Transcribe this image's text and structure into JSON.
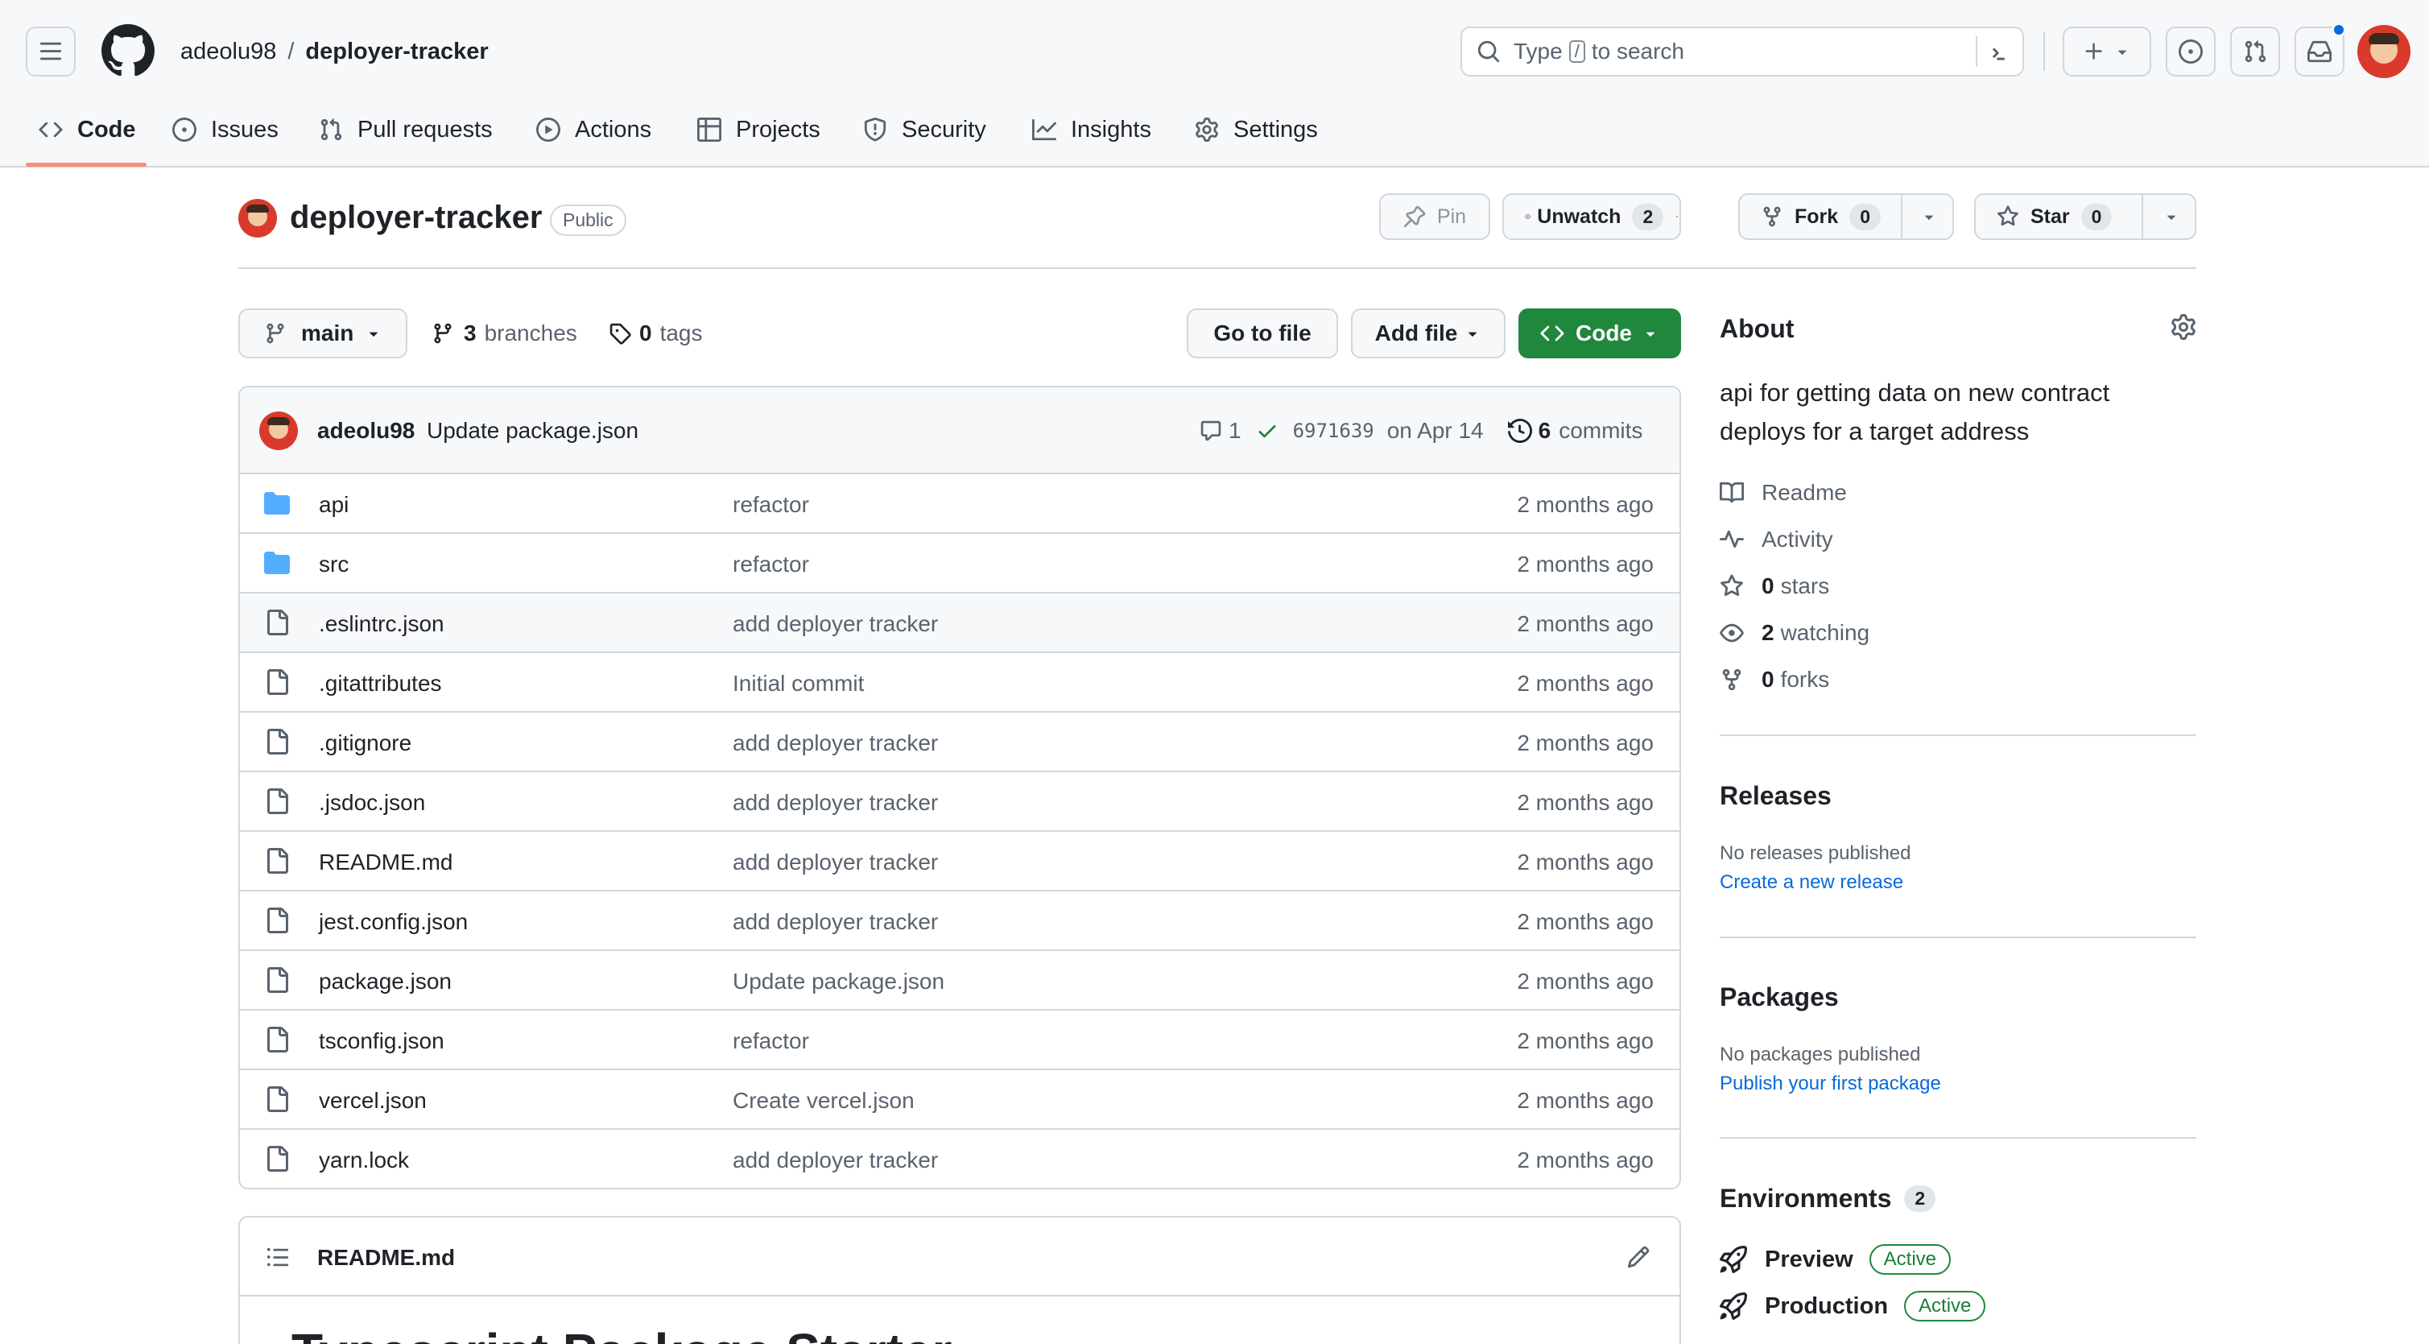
{
  "header": {
    "owner": "adeolu98",
    "separator": "/",
    "repo": "deployer-tracker",
    "search_prefix": "Type",
    "search_key": "/",
    "search_suffix": "to search"
  },
  "nav": {
    "tabs": [
      {
        "label": "Code",
        "icon": "code-icon"
      },
      {
        "label": "Issues",
        "icon": "issue-icon"
      },
      {
        "label": "Pull requests",
        "icon": "pull-request-icon"
      },
      {
        "label": "Actions",
        "icon": "play-icon"
      },
      {
        "label": "Projects",
        "icon": "table-icon"
      },
      {
        "label": "Security",
        "icon": "shield-icon"
      },
      {
        "label": "Insights",
        "icon": "graph-icon"
      },
      {
        "label": "Settings",
        "icon": "gear-icon"
      }
    ]
  },
  "repo": {
    "name": "deployer-tracker",
    "visibility": "Public",
    "pin": "Pin",
    "unwatch": "Unwatch",
    "watch_count": "2",
    "fork": "Fork",
    "fork_count": "0",
    "star": "Star",
    "star_count": "0"
  },
  "toolbar": {
    "branch": "main",
    "branches_count": "3",
    "branches_label": "branches",
    "tags_count": "0",
    "tags_label": "tags",
    "goto_file": "Go to file",
    "add_file": "Add file",
    "code": "Code"
  },
  "commit": {
    "author": "adeolu98",
    "message": "Update package.json",
    "comments": "1",
    "sha": "6971639",
    "date": "on Apr 14",
    "commits_count": "6",
    "commits_label": "commits"
  },
  "files": [
    {
      "name": "api",
      "type": "dir",
      "message": "refactor",
      "age": "2 months ago"
    },
    {
      "name": "src",
      "type": "dir",
      "message": "refactor",
      "age": "2 months ago"
    },
    {
      "name": ".eslintrc.json",
      "type": "file",
      "message": "add deployer tracker",
      "age": "2 months ago"
    },
    {
      "name": ".gitattributes",
      "type": "file",
      "message": "Initial commit",
      "age": "2 months ago"
    },
    {
      "name": ".gitignore",
      "type": "file",
      "message": "add deployer tracker",
      "age": "2 months ago"
    },
    {
      "name": ".jsdoc.json",
      "type": "file",
      "message": "add deployer tracker",
      "age": "2 months ago"
    },
    {
      "name": "README.md",
      "type": "file",
      "message": "add deployer tracker",
      "age": "2 months ago"
    },
    {
      "name": "jest.config.json",
      "type": "file",
      "message": "add deployer tracker",
      "age": "2 months ago"
    },
    {
      "name": "package.json",
      "type": "file",
      "message": "Update package.json",
      "age": "2 months ago"
    },
    {
      "name": "tsconfig.json",
      "type": "file",
      "message": "refactor",
      "age": "2 months ago"
    },
    {
      "name": "vercel.json",
      "type": "file",
      "message": "Create vercel.json",
      "age": "2 months ago"
    },
    {
      "name": "yarn.lock",
      "type": "file",
      "message": "add deployer tracker",
      "age": "2 months ago"
    }
  ],
  "readme": {
    "file": "README.md",
    "heading": "Typescript Package Starter"
  },
  "about": {
    "title": "About",
    "description": "api for getting data on new contract deploys for a target address",
    "readme": "Readme",
    "activity": "Activity",
    "stars_count": "0",
    "stars_label": "stars",
    "watching_count": "2",
    "watching_label": "watching",
    "forks_count": "0",
    "forks_label": "forks"
  },
  "releases": {
    "title": "Releases",
    "empty": "No releases published",
    "link": "Create a new release"
  },
  "packages": {
    "title": "Packages",
    "empty": "No packages published",
    "link": "Publish your first package"
  },
  "environments": {
    "title": "Environments",
    "count": "2",
    "items": [
      {
        "name": "Preview",
        "status": "Active"
      },
      {
        "name": "Production",
        "status": "Active"
      }
    ]
  },
  "colors": {
    "accent_underline": "#fd8c73",
    "primary_green": "#1f883d",
    "link_blue": "#0969da",
    "folder_blue": "#54aeff",
    "notification_dot": "#0969da"
  }
}
